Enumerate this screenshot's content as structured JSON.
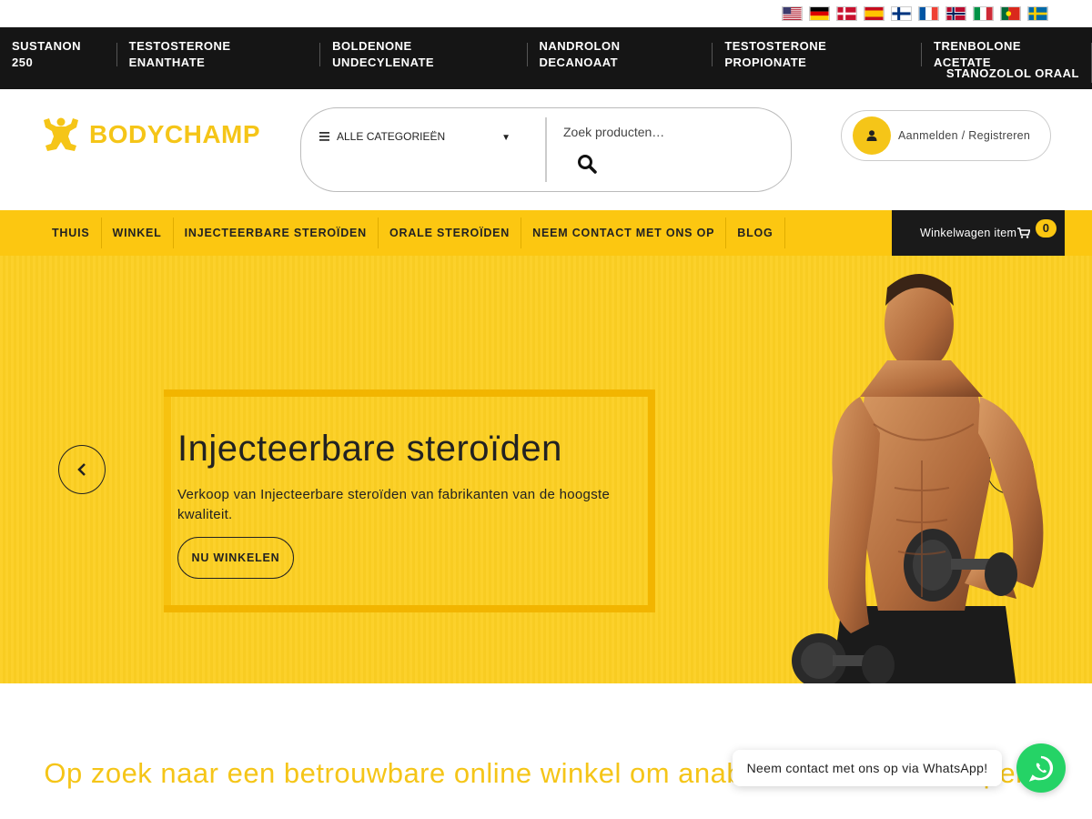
{
  "flags": [
    "flag-us",
    "flag-de",
    "flag-dk",
    "flag-es",
    "flag-fi",
    "flag-fr",
    "flag-no",
    "flag-it",
    "flag-pt",
    "flag-se"
  ],
  "top_nav": {
    "row1": [
      "SUSTANON 250",
      "TESTOSTERONE ENANTHATE",
      "BOLDENONE UNDECYLENATE",
      "NANDROLON DECANOAAT",
      "TESTOSTERONE PROPIONATE",
      "TRENBOLONE ACETATE"
    ],
    "row2": [
      "STANOZOLOL ORAAL"
    ]
  },
  "header": {
    "logo_text": "BODYCHAMP",
    "category_label": "ALLE CATEGORIEËN",
    "search_placeholder": "Zoek producten…",
    "account_label": "Aanmelden / Registreren"
  },
  "main_nav": [
    "THUIS",
    "WINKEL",
    "INJECTEERBARE STEROÏDEN",
    "ORALE STEROÏDEN",
    "NEEM CONTACT MET ONS OP",
    "BLOG"
  ],
  "cart": {
    "label": "Winkelwagen item",
    "count": "0"
  },
  "hero": {
    "title": "Injecteerbare steroïden",
    "subtitle": "Verkoop van Injecteerbare steroïden van fabrikanten van de hoogste kwaliteit.",
    "button": "NU WINKELEN"
  },
  "section_heading": "Op zoek naar een betrouwbare online winkel om anabole steroïden te kopen?",
  "whatsapp": {
    "message": "Neem contact met ons op via WhatsApp!"
  },
  "colors": {
    "accent": "#fcc711",
    "dark": "#151515",
    "whatsapp": "#25d366"
  }
}
